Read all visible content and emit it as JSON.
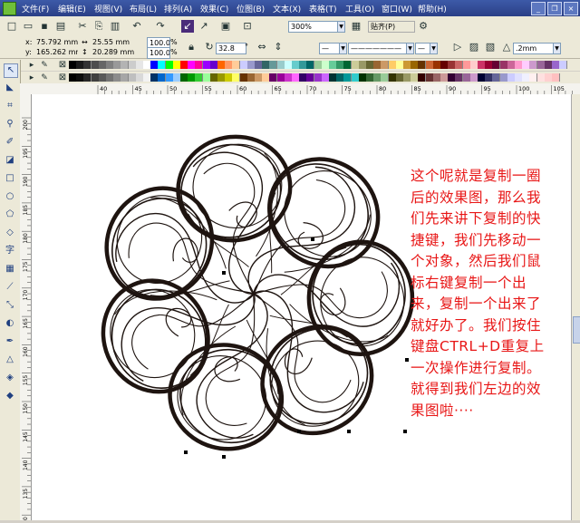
{
  "menubar": {
    "items": [
      "文件(F)",
      "编辑(E)",
      "视图(V)",
      "布局(L)",
      "排列(A)",
      "效果(C)",
      "位图(B)",
      "文本(X)",
      "表格(T)",
      "工具(O)",
      "窗口(W)",
      "帮助(H)"
    ]
  },
  "toolbar": {
    "zoom_value": "300%",
    "snap_label": "贴齐(P)"
  },
  "property_bar": {
    "x_label": "x:",
    "x_value": "75.792 mm",
    "y_label": "y:",
    "y_value": "165.262 mm",
    "width_value": "25.55 mm",
    "height_value": "20.289 mm",
    "scale_x": "100.0",
    "scale_y": "100.0",
    "percent_x": "%",
    "percent_y": "%",
    "rotation_value": "32.8",
    "rotation_unit": "°",
    "outline_width": ".2mm"
  },
  "ruler": {
    "h_ticks": [
      "40",
      "45",
      "50",
      "55",
      "60",
      "65",
      "70",
      "75",
      "80",
      "85",
      "90",
      "95",
      "100",
      "105",
      "110"
    ],
    "v_ticks": [
      "200",
      "195",
      "190",
      "185",
      "180",
      "175",
      "170",
      "165",
      "160",
      "155",
      "150",
      "145",
      "140",
      "135",
      "130"
    ]
  },
  "palette": {
    "row1": [
      "#000000",
      "#1a1a1a",
      "#333333",
      "#4d4d4d",
      "#666666",
      "#808080",
      "#999999",
      "#b3b3b3",
      "#cccccc",
      "#e6e6e6",
      "#ffffff",
      "#0000ff",
      "#00ffff",
      "#00ff00",
      "#ffff00",
      "#ff0000",
      "#ff00ff",
      "#ff0099",
      "#9900ff",
      "#6600cc",
      "#ff6600",
      "#ff9966",
      "#ffcc99",
      "#ccccff",
      "#9999cc",
      "#666699",
      "#336666",
      "#669999",
      "#99cccc",
      "#ccffff",
      "#66cccc",
      "#339999",
      "#006666",
      "#99cc99",
      "#ccffcc",
      "#66cc99",
      "#339966",
      "#006633",
      "#cccc99",
      "#999966",
      "#666633",
      "#996633",
      "#cc9966",
      "#ffcc66",
      "#ffff99",
      "#cc9933",
      "#996600",
      "#663300",
      "#cc6633",
      "#993300",
      "#660000",
      "#993333",
      "#cc6666",
      "#ff9999",
      "#ffcccc",
      "#cc3366",
      "#990033",
      "#660033",
      "#993366",
      "#cc6699",
      "#ff99cc",
      "#ffccff",
      "#cc99cc",
      "#996699",
      "#663366",
      "#9966cc",
      "#ccccff"
    ],
    "row2": [
      "#000000",
      "#0d0d0d",
      "#262626",
      "#404040",
      "#595959",
      "#737373",
      "#8c8c8c",
      "#a6a6a6",
      "#bfbfbf",
      "#d9d9d9",
      "#f2f2f2",
      "#003366",
      "#0066cc",
      "#3399ff",
      "#99ccff",
      "#006600",
      "#009900",
      "#33cc33",
      "#99ff99",
      "#666600",
      "#999900",
      "#cccc00",
      "#ffff66",
      "#663300",
      "#996633",
      "#cc9966",
      "#ffcc99",
      "#660066",
      "#990099",
      "#cc33cc",
      "#ff66ff",
      "#330066",
      "#660099",
      "#9933cc",
      "#cc66ff",
      "#003333",
      "#006666",
      "#009999",
      "#33cccc",
      "#003300",
      "#336633",
      "#669966",
      "#99cc99",
      "#333300",
      "#666633",
      "#999966",
      "#cccc99",
      "#330000",
      "#663333",
      "#996666",
      "#cc9999",
      "#330033",
      "#663366",
      "#996699",
      "#cc99cc",
      "#000033",
      "#333366",
      "#666699",
      "#9999cc",
      "#ccccff",
      "#e0e0ff",
      "#f0f0ff",
      "#fff0f0",
      "#ffe0e0",
      "#ffd0d0",
      "#ffc0c0"
    ]
  },
  "annotation": {
    "lines": [
      "这个呢就是复制一圈",
      "后的效果图，那么我",
      "们先来讲下复制的快",
      "捷键，我们先移动一",
      "个对象，然后我们鼠",
      "标右键复制一个出",
      "来，复制一个出来了",
      "就好办了。我们按住",
      "键盘CTRL+D重复上",
      "一次操作进行复制。",
      "就得到我们左边的效",
      "果图啦····"
    ],
    "color": "#e81616"
  },
  "drawing": {
    "stroke_color": "#1e1410",
    "loops": 7
  }
}
